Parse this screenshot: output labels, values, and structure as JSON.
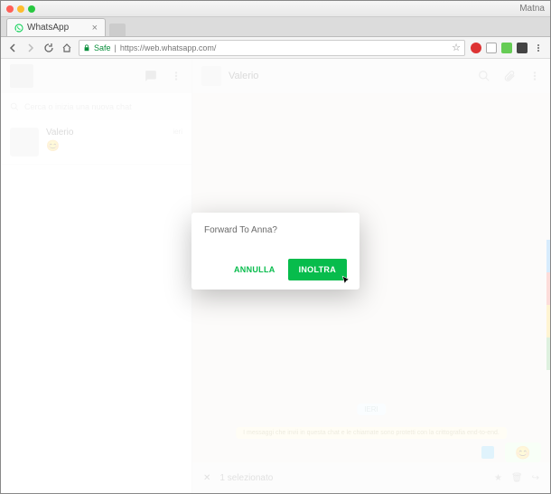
{
  "window": {
    "title": "Matna"
  },
  "browser": {
    "tab": {
      "title": "WhatsApp",
      "close": "×"
    },
    "addr": {
      "secure_label": "Safe",
      "url": "https://web.whatsapp.com/"
    }
  },
  "sidebar": {
    "search_placeholder": "Cerca o inizia una nuova chat",
    "chats": [
      {
        "name": "Valerio",
        "time": "ieri",
        "emoji": "😊"
      }
    ]
  },
  "conversation": {
    "contact_name": "Valerio",
    "date_label": "IERI",
    "encryption_text": "I messaggi che invii in questa chat e le chiamate sono protetti con la crittografia end-to-end.",
    "last_msg_emoji": "😊"
  },
  "selection_bar": {
    "close": "✕",
    "label": "1 selezionato"
  },
  "dialog": {
    "title": "Forward To Anna?",
    "cancel": "ANNULLA",
    "confirm": "INOLTRA"
  },
  "colors": {
    "accent": "#07bc4c"
  }
}
